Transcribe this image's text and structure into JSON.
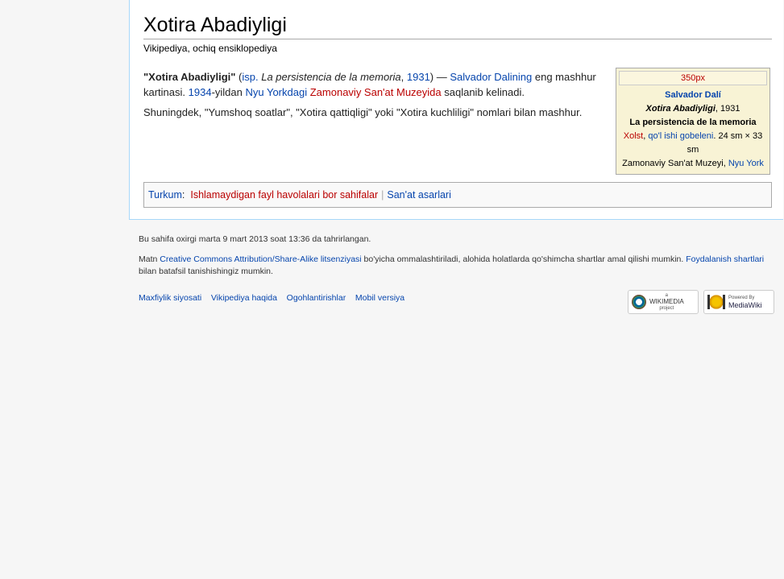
{
  "article": {
    "title": "Xotira Abadiyligi",
    "subtitle": "Vikipediya, ochiq ensiklopediya",
    "p1": {
      "bold": "\"Xotira Abadiyligi\"",
      "open": " (",
      "isp": "isp.",
      "spanish_title": " La persistencia de la memoria",
      "comma": ", ",
      "year": "1931",
      "close_dash": ") — ",
      "artist": "Salvador Dalining",
      "t1": " eng mashhur kartinasi. ",
      "year2": "1934",
      "t2": "-yildan ",
      "nyc": "Nyu Yorkdagi",
      "t3": " ",
      "museum": "Zamonaviy San'at Muzeyida",
      "t4": " saqlanib kelinadi."
    },
    "p2": "Shuningdek, \"Yumshoq soatlar\", \"Xotira qattiqligi\" yoki \"Xotira kuchliligi\" nomlari bilan mashhur."
  },
  "infobox": {
    "image_label": "350px",
    "artist": "Salvador Dalí",
    "title_italic": "Xotira Abadiyligi",
    "year": ", 1931",
    "original_title": "La persistencia de la memoria",
    "medium1": "Xolst",
    "medium_sep": ", ",
    "medium2": "qo'l ishi gobeleni",
    "size": ". 24 sm × 33 sm",
    "location": "Zamonaviy San'at Muzeyi, ",
    "city": "Nyu York"
  },
  "categories": {
    "label": "Turkum",
    "colon": ":",
    "items": [
      "Ishlamaydigan fayl havolalari bor sahifalar",
      "San'at asarlari"
    ]
  },
  "footer": {
    "lastmod": "Bu sahifa oxirgi marta 9 mart 2013 soat 13:36 da tahrirlangan.",
    "lic_pre": "Matn ",
    "lic_link": "Creative Commons Attribution/Share-Alike litsenziyasi",
    "lic_mid": " bo'yicha ommalashtiriladi, alohida holatlarda qo'shimcha shartlar amal qilishi mumkin. ",
    "terms_link": "Foydalanish shartlari",
    "lic_end": " bilan batafsil tanishishingiz mumkin.",
    "places": [
      "Maxfiylik siyosati",
      "Vikipediya haqida",
      "Ogohlantirishlar",
      "Mobil versiya"
    ],
    "badge1": {
      "small": "a",
      "main": "WIKIMEDIA",
      "sub": "project"
    },
    "badge2": {
      "small": "Powered By",
      "main": "MediaWiki"
    }
  },
  "colors": {
    "link": "#0645ad",
    "redlink": "#ba0000",
    "infobox_bg": "#f8f3d5",
    "border": "#a7d7f9"
  }
}
